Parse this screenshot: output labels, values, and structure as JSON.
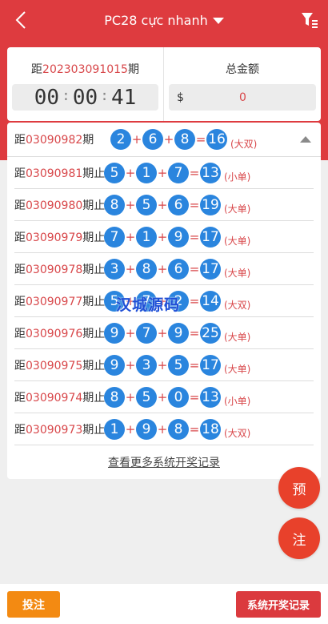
{
  "header": {
    "title": "PC28 cực nhanh",
    "back_icon": "chevron-left-icon",
    "filter_icon": "filter-icon"
  },
  "current": {
    "prefix": "距",
    "period": "202303091015",
    "suffix": "期",
    "countdown": {
      "h": "00",
      "m": "00",
      "s": "41"
    }
  },
  "total": {
    "label": "总金额",
    "currency": "$",
    "value": "0"
  },
  "results": [
    {
      "prefix": "距",
      "period": "03090982",
      "suffix": "期",
      "b1": "2",
      "b2": "6",
      "b3": "8",
      "sum": "16",
      "tag": "(大双)"
    },
    {
      "prefix": "距",
      "period": "03090981",
      "suffix": "期止",
      "b1": "5",
      "b2": "1",
      "b3": "7",
      "sum": "13",
      "tag": "(小单)"
    },
    {
      "prefix": "距",
      "period": "03090980",
      "suffix": "期止",
      "b1": "8",
      "b2": "5",
      "b3": "6",
      "sum": "19",
      "tag": "(大单)"
    },
    {
      "prefix": "距",
      "period": "03090979",
      "suffix": "期止",
      "b1": "7",
      "b2": "1",
      "b3": "9",
      "sum": "17",
      "tag": "(大单)"
    },
    {
      "prefix": "距",
      "period": "03090978",
      "suffix": "期止",
      "b1": "3",
      "b2": "8",
      "b3": "6",
      "sum": "17",
      "tag": "(大单)"
    },
    {
      "prefix": "距",
      "period": "03090977",
      "suffix": "期止",
      "b1": "5",
      "b2": "7",
      "b3": "2",
      "sum": "14",
      "tag": "(大双)"
    },
    {
      "prefix": "距",
      "period": "03090976",
      "suffix": "期止",
      "b1": "9",
      "b2": "7",
      "b3": "9",
      "sum": "25",
      "tag": "(大单)"
    },
    {
      "prefix": "距",
      "period": "03090975",
      "suffix": "期止",
      "b1": "9",
      "b2": "3",
      "b3": "5",
      "sum": "17",
      "tag": "(大单)"
    },
    {
      "prefix": "距",
      "period": "03090974",
      "suffix": "期止",
      "b1": "8",
      "b2": "5",
      "b3": "0",
      "sum": "13",
      "tag": "(小单)"
    },
    {
      "prefix": "距",
      "period": "03090973",
      "suffix": "期止",
      "b1": "1",
      "b2": "9",
      "b3": "8",
      "sum": "18",
      "tag": "(大双)"
    }
  ],
  "ops": {
    "plus": "+",
    "eq": "="
  },
  "more_link": "查看更多系统开奖记录",
  "watermark": "汉城源码",
  "float": {
    "pre": "预",
    "zhu": "注"
  },
  "bottom": {
    "bet": "投注",
    "history": "系统开奖记录"
  },
  "colors": {
    "brand_red": "#de3b3f",
    "ball_blue": "#2a85de",
    "bet_orange": "#f38a12",
    "float_red": "#e8412b"
  }
}
